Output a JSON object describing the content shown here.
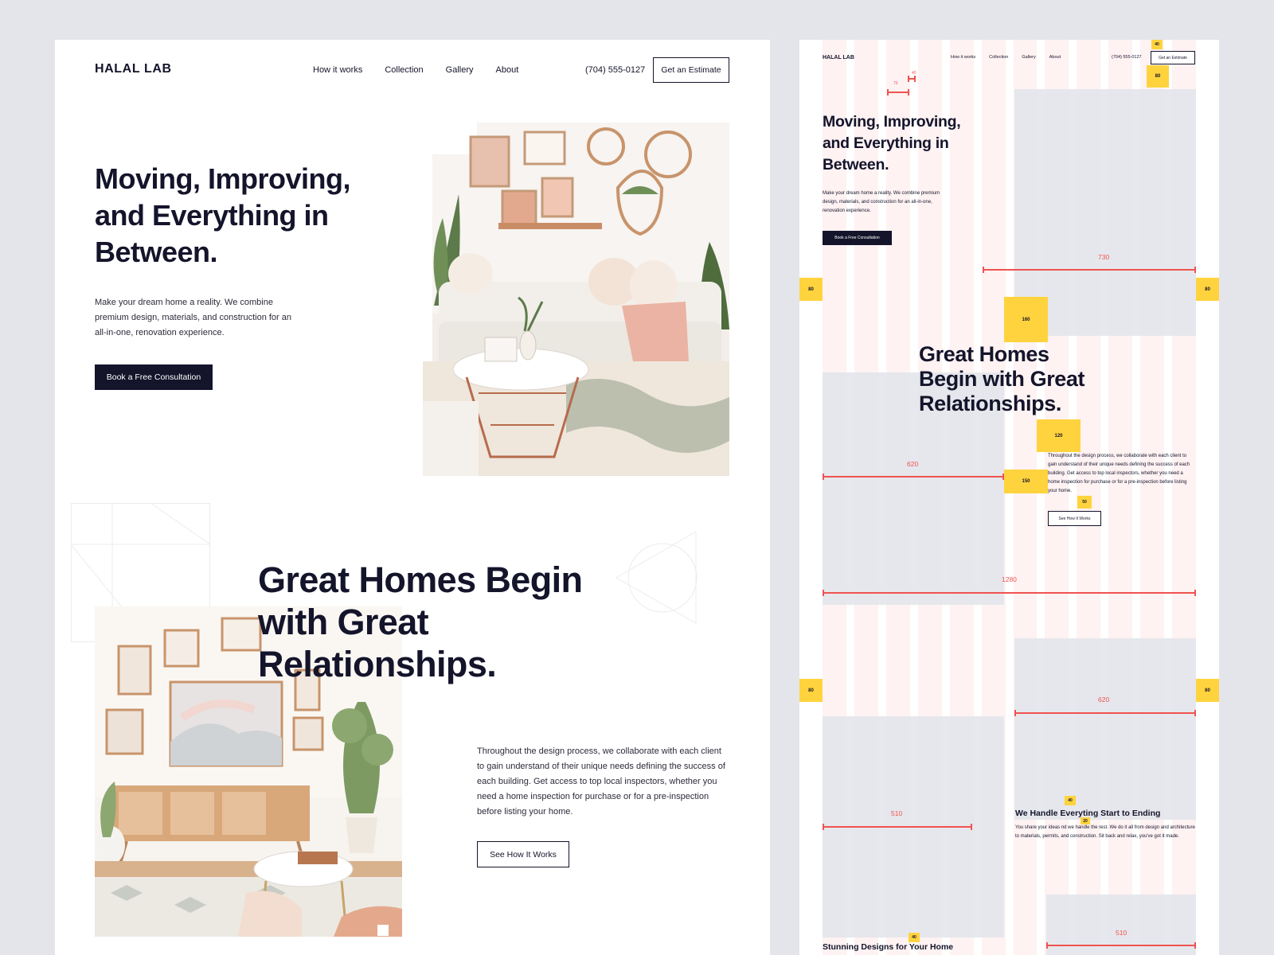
{
  "left_page": {
    "logo": "HALAL LAB",
    "nav": [
      "How it works",
      "Collection",
      "Gallery",
      "About"
    ],
    "phone": "(704) 555-0127",
    "estimate_button": "Get an Estimate",
    "hero": {
      "title": "Moving, Improving, and Everything in Between.",
      "text": "Make your dream home a reality. We combine premium design, materials, and construction for an all-in-one, renovation experience.",
      "button": "Book a Free Consultation"
    },
    "section2": {
      "title": "Great Homes Begin with Great Relationships.",
      "text": "Throughout the design process, we collaborate with each client to gain understand of their unique needs defining the success of each building. Get access to top local inspectors, whether you need a home inspection for purchase or for a pre-inspection before listing your home.",
      "button": "See How It Works"
    }
  },
  "right_page": {
    "logo": "HALAL LAB",
    "nav": [
      "How it works",
      "Collection",
      "Gallery",
      "About"
    ],
    "phone": "(704) 555-0127",
    "estimate_button": "Get an Estimate",
    "hero_title": "Moving, Improving, and Everything in Between.",
    "hero_text": "Make your dream home a reality. We combine premium design, materials, and construction for an all-in-one, renovation experience.",
    "hero_button": "Book a Free Consultation",
    "section2_title": "Great Homes Begin with Great Relationships.",
    "section2_text": "Throughout the design process, we collaborate with each client to gain understand of their unique needs defining the success of each building. Get access to top local inspectors, whether you need a home inspection for purchase or for a pre-inspection before listing your home.",
    "section2_button": "See How It Works",
    "section3_title": "We Handle Everyting Start to Ending",
    "section3_text": "You share your ideas nd we handle the rest. We do it all from design and architecture to materials, permits, and construction. Sit back and relax, you've got it made.",
    "section4_title": "Stunning Designs for Your Home",
    "spacing_labels": {
      "top": "40",
      "nav_gap": "80",
      "small_a": "70",
      "small_b": "40",
      "margin_l1": "80",
      "margin_r1": "80",
      "gap_160": "160",
      "gap_120": "120",
      "gap_150": "150",
      "gap_50": "50",
      "margin_l2": "80",
      "margin_r2": "80",
      "gap_40a": "40",
      "gap_20": "20",
      "gap_40b": "40"
    },
    "measure_labels": {
      "w730": "730",
      "w620a": "620",
      "w1280": "1280",
      "w620b": "620",
      "w510a": "510",
      "w510b": "510"
    }
  }
}
